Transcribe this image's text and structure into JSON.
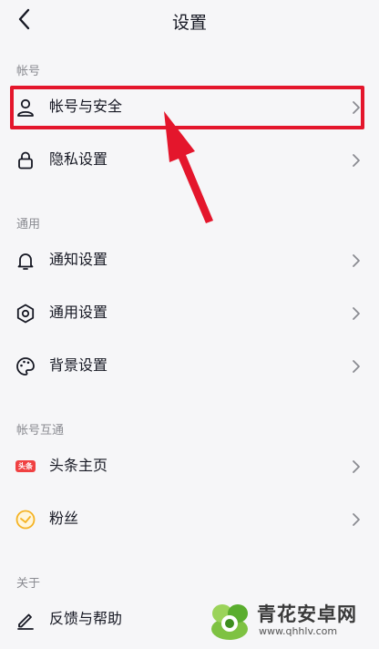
{
  "header": {
    "title": "设置"
  },
  "sections": [
    {
      "label": "帐号"
    },
    {
      "label": "通用"
    },
    {
      "label": "帐号互通"
    },
    {
      "label": "关于"
    }
  ],
  "items": {
    "account_security": "帐号与安全",
    "privacy": "隐私设置",
    "notifications": "通知设置",
    "general": "通用设置",
    "background": "背景设置",
    "toutiao_home": "头条主页",
    "fans": "粉丝",
    "feedback": "反馈与帮助"
  },
  "toutiao_badge": "头条",
  "watermark": {
    "name": "青花安卓网",
    "url": "www.qhhlv.com"
  },
  "colors": {
    "highlight": "#e4162c",
    "toutiao_badge": "#f04142",
    "fans_icon": "#f5b324"
  }
}
